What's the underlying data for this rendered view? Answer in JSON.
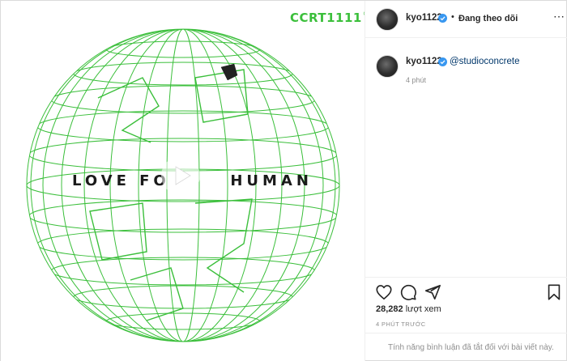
{
  "media": {
    "brand": "CCRT",
    "brand_digits": "1111",
    "brand_mark": "®",
    "overlay_text": "LOVE FO",
    "overlay_text_2": "HUMAN",
    "accent": "#3bbf3b"
  },
  "header": {
    "username": "kyo1122",
    "separator": "•",
    "follow_status": "Đang theo dõi",
    "more_icon": "more-icon"
  },
  "caption": {
    "username": "kyo1122",
    "mention": "@studioconcrete",
    "time_ago": "4 phút"
  },
  "actions": {
    "icons": [
      "heart-icon",
      "comment-icon",
      "share-icon",
      "bookmark-icon"
    ]
  },
  "stats": {
    "views_count": "28,282",
    "views_label": " lượt xem",
    "posted_time": "4 PHÚT TRƯỚC"
  },
  "comments": {
    "disabled_notice": "Tính năng bình luận đã tắt đối với bài viết này."
  },
  "colors": {
    "link": "#00376b",
    "muted": "#8e8e8e",
    "verified": "#3897f0",
    "globe_lines": "#3bbf3b"
  }
}
